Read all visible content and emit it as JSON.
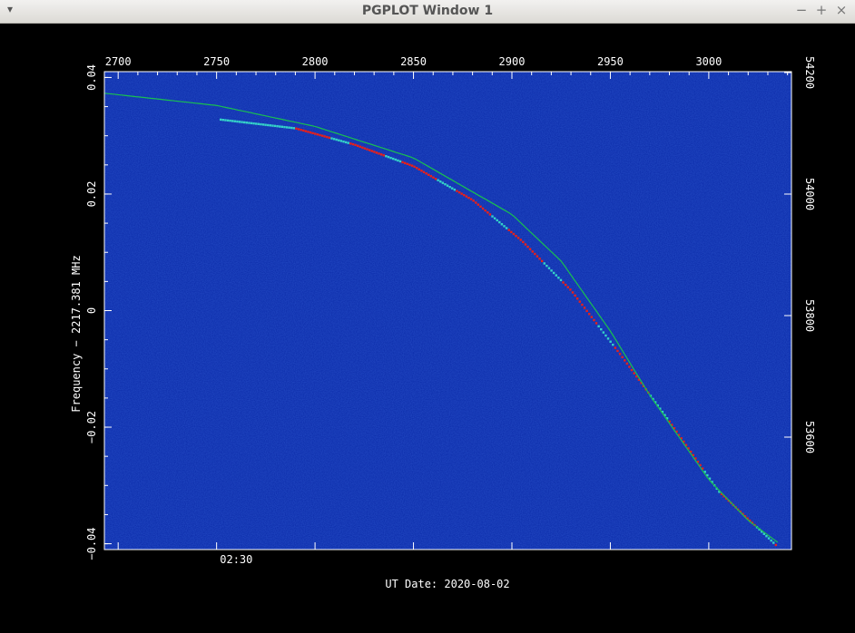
{
  "window": {
    "title": "PGPLOT Window 1",
    "controls": {
      "menu": "▾",
      "minimize": "−",
      "maximize": "+",
      "close": "×"
    }
  },
  "colors": {
    "background": "#000000",
    "plot_background": "#0a2aa8",
    "trace_cyan": "#35d2c8",
    "trace_red": "#e8201a",
    "model_curve": "#19c050",
    "axis": "#ffffff"
  },
  "chart_data": {
    "type": "heatmap",
    "description_ylabel": "Frequency − 2217.381 MHz",
    "ylabel": "Frequency − 2217.381 MHz",
    "xlabel": "UT Date: 2020-08-02",
    "bottom_tick_labels": [
      "02:30"
    ],
    "bottom_tick_values": [
      2760
    ],
    "x_range": [
      2693,
      3042
    ],
    "y_range": [
      -0.041,
      0.041
    ],
    "top_axis": {
      "ticks": [
        2700,
        2750,
        2800,
        2850,
        2900,
        2950,
        3000
      ],
      "labels": [
        "2700",
        "2750",
        "2800",
        "2850",
        "2900",
        "2950",
        "3000"
      ]
    },
    "left_axis": {
      "ticks": [
        0.04,
        0.02,
        0,
        -0.02,
        -0.04
      ],
      "labels": [
        "0.04",
        "0.02",
        "0",
        "−0.02",
        "−0.04"
      ]
    },
    "right_axis": {
      "ticks": [
        54200,
        54000,
        53800,
        53600
      ],
      "labels": [
        "54200",
        "54000",
        "53800",
        "53600"
      ]
    },
    "model_curve": {
      "x": [
        2693,
        2750,
        2800,
        2850,
        2900,
        2925,
        2950,
        2970,
        3000,
        3020,
        3036
      ],
      "y": [
        0.0373,
        0.0352,
        0.0316,
        0.0262,
        0.0165,
        0.0085,
        -0.0035,
        -0.0145,
        -0.029,
        -0.036,
        -0.04
      ]
    },
    "signal_trace": {
      "x": [
        2752,
        2790,
        2820,
        2850,
        2880,
        2905,
        2930,
        2955,
        2980,
        3005,
        3035
      ],
      "y": [
        0.0328,
        0.0313,
        0.0285,
        0.0248,
        0.019,
        0.012,
        0.0035,
        -0.0075,
        -0.019,
        -0.031,
        -0.0405
      ]
    },
    "grid": false,
    "colorscale": "blue-cyan-red"
  }
}
